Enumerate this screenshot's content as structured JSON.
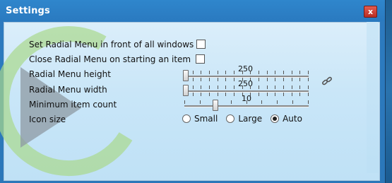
{
  "window": {
    "title": "Settings",
    "close_glyph": "x"
  },
  "settings": {
    "front_label": "Set Radial Menu in front of all windows",
    "front_checked": false,
    "close_label": "Close Radial Menu on starting an item",
    "close_checked": false,
    "height": {
      "label": "Radial Menu height",
      "value": "250",
      "position": 0
    },
    "width": {
      "label": "Radial Menu width",
      "value": "250",
      "position": 0
    },
    "min_count": {
      "label": "Minimum item count",
      "value": "10",
      "position": 0.25
    },
    "icon_size": {
      "label": "Icon size",
      "options": [
        "Small",
        "Large",
        "Auto"
      ],
      "selected": "Auto"
    }
  },
  "icons": {
    "link": "chain-link-icon",
    "logo": "radial-menu-logo",
    "close": "close-icon"
  },
  "colors": {
    "titlebar": "#2a7ac0",
    "close_button": "#c8382c",
    "client_bg": "#cfe8f8"
  }
}
